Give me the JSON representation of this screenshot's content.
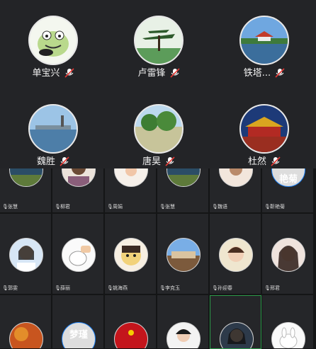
{
  "featured": [
    {
      "name": "单宝兴",
      "avatar": "frog"
    },
    {
      "name": "卢雷锋",
      "avatar": "pine-tree"
    },
    {
      "name": "铁塔...",
      "avatar": "lake-pavilion"
    },
    {
      "name": "魏胜",
      "avatar": "coast"
    },
    {
      "name": "唐昊",
      "avatar": "field"
    },
    {
      "name": "杜然",
      "avatar": "palace"
    }
  ],
  "row1": [
    {
      "name": "张慧",
      "avatar": "landscape-dark"
    },
    {
      "name": "柳君",
      "avatar": "girl"
    },
    {
      "name": "周娟",
      "avatar": "cartoon-kid"
    },
    {
      "name": "张慧",
      "avatar": "landscape-dark"
    },
    {
      "name": "魏语",
      "avatar": "girl-light"
    },
    {
      "name": "靳艳菊",
      "avatar_text": "艳菊"
    }
  ],
  "row2": [
    {
      "name": "郭雯",
      "avatar": "woman-portrait"
    },
    {
      "name": "薛丽",
      "avatar": "white-rabbit"
    },
    {
      "name": "姚海燕",
      "avatar": "cartoon-girl"
    },
    {
      "name": "李克玉",
      "avatar": "building"
    },
    {
      "name": "孙迎春",
      "avatar": "girl-short-hair"
    },
    {
      "name": "邢君",
      "avatar": "woman-long-hair"
    }
  ],
  "row3": [
    {
      "avatar": "autumn"
    },
    {
      "avatar_text": "梦瑾"
    },
    {
      "avatar": "red-flag"
    },
    {
      "avatar": "woman-white"
    },
    {
      "avatar": "woman-dark"
    },
    {
      "avatar": "bunny"
    }
  ]
}
